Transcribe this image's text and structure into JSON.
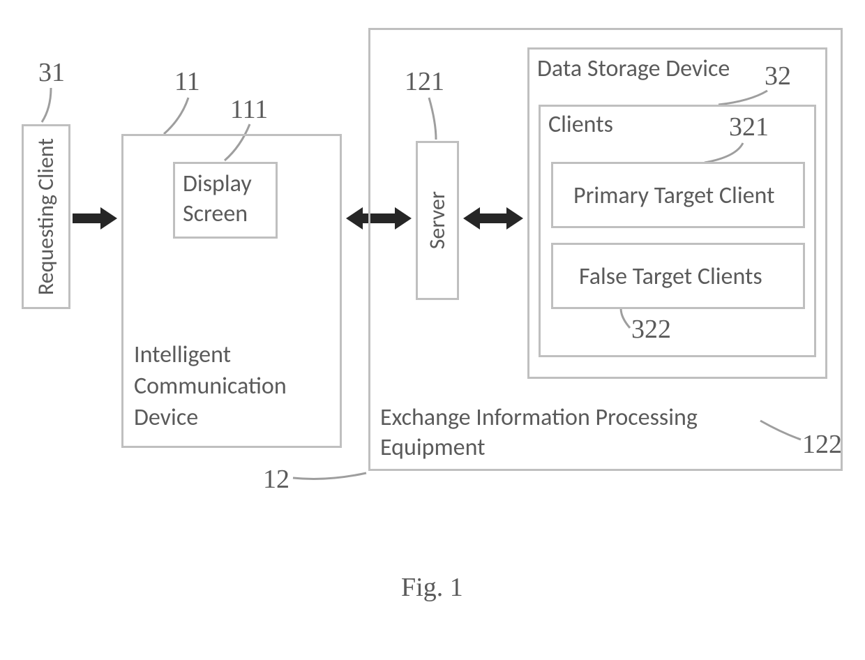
{
  "labels": {
    "requesting_client": "Requesting",
    "requesting_client2": "Client",
    "intelligent_comm_l1": "Intelligent",
    "intelligent_comm_l2": "Communication",
    "intelligent_comm_l3": "Device",
    "display_l1": "Display",
    "display_l2": "Screen",
    "server": "Server",
    "exchange_l1": "Exchange Information Processing",
    "exchange_l2": "Equipment",
    "data_storage": "Data Storage Device",
    "clients": "Clients",
    "primary_target": "Primary Target Client",
    "false_target": "False Target Clients"
  },
  "refs": {
    "r31": "31",
    "r11": "11",
    "r111": "111",
    "r121": "121",
    "r32": "32",
    "r321": "321",
    "r322": "322",
    "r12": "12",
    "r122": "122"
  },
  "caption": "Fig. 1"
}
